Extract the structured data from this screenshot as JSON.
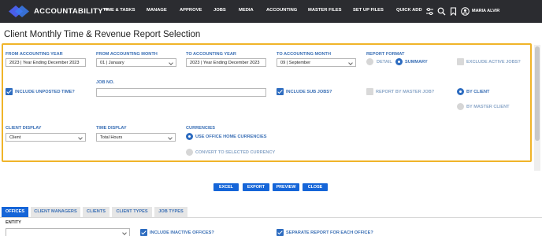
{
  "nav": {
    "logo_text": "ACCOUNTABILITY",
    "logo_tm": "TM",
    "items": [
      "TIME & TASKS",
      "MANAGE",
      "APPROVE",
      "JOBS",
      "MEDIA",
      "ACCOUNTING",
      "MASTER FILES",
      "SET UP FILES",
      "QUICK ADD"
    ],
    "icons": [
      "sliders-icon",
      "search-icon",
      "bookmark-icon",
      "user-icon"
    ],
    "user_name": "MARIA ALVIR"
  },
  "page_title": "Client Monthly Time & Revenue Report Selection",
  "form": {
    "from_year": {
      "label": "FROM ACCOUNTING YEAR",
      "value": "2023 | Year Ending December 2023"
    },
    "from_month": {
      "label": "FROM ACCOUNTING MONTH",
      "value": "01 | January"
    },
    "to_year": {
      "label": "TO ACCOUNTING YEAR",
      "value": "2023 | Year Ending December 2023"
    },
    "to_month": {
      "label": "TO ACCOUNTING MONTH",
      "value": "09 | September"
    },
    "report_format": {
      "label": "REPORT FORMAT",
      "options": [
        "DETAIL",
        "SUMMARY"
      ],
      "selected": "SUMMARY"
    },
    "exclude_active_jobs": {
      "label": "EXCLUDE ACTIVE JOBS?",
      "checked": false
    },
    "include_unposted_time": {
      "label": "INCLUDE UNPOSTED TIME?",
      "checked": true
    },
    "job_no": {
      "label": "JOB NO.",
      "value": ""
    },
    "include_sub_jobs": {
      "label": "INCLUDE SUB JOBS?",
      "checked": true
    },
    "report_by_master_job": {
      "label": "REPORT BY MASTER JOB?",
      "checked": false
    },
    "group_by": {
      "options": [
        "BY CLIENT",
        "BY MASTER CLIENT"
      ],
      "selected": "BY CLIENT"
    },
    "client_display": {
      "label": "CLIENT DISPLAY",
      "value": "Client"
    },
    "time_display": {
      "label": "TIME DISPLAY",
      "value": "Total Hours"
    },
    "currencies": {
      "label": "CURRENCIES",
      "options": [
        "USE OFFICE HOME CURRENCIES",
        "CONVERT TO SELECTED CURRENCY"
      ],
      "selected": "USE OFFICE HOME CURRENCIES"
    }
  },
  "actions": [
    "EXCEL",
    "EXPORT",
    "PREVIEW",
    "CLOSE"
  ],
  "tabs": {
    "items": [
      "OFFICES",
      "CLIENT MANAGERS",
      "CLIENTS",
      "CLIENT TYPES",
      "JOB TYPES"
    ],
    "active": "OFFICES"
  },
  "offices": {
    "entity": {
      "label": "ENTITY",
      "value": ""
    },
    "include_inactive_offices": {
      "label": "INCLUDE INACTIVE OFFICES?",
      "checked": true
    },
    "separate_report": {
      "label": "SEPARATE REPORT FOR EACH OFFICE?",
      "checked": true
    }
  },
  "colors": {
    "accent": "#1565d8",
    "label_blue": "#3a6fb5",
    "panel_border": "#f0b429",
    "topbar": "#2b2c30"
  }
}
